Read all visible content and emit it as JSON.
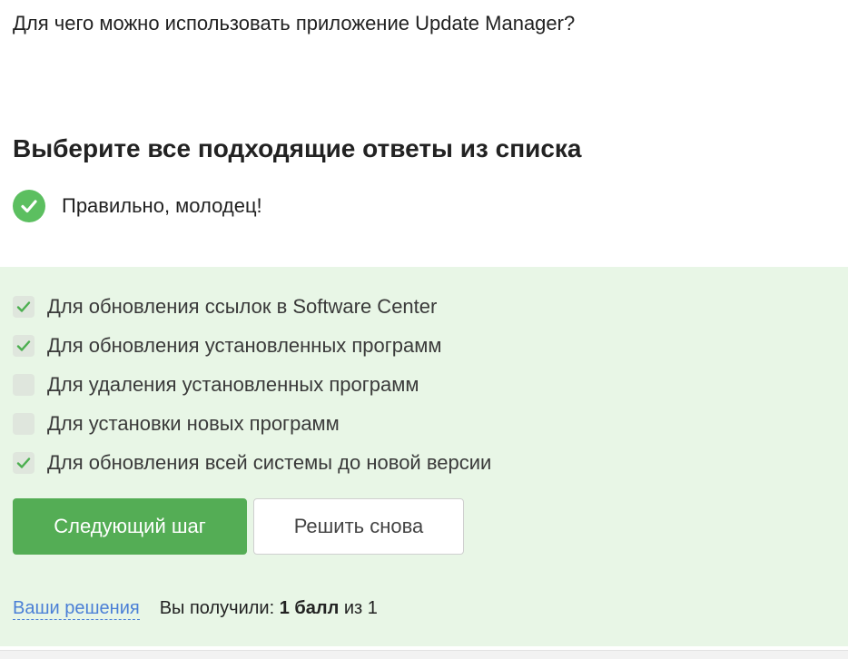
{
  "question": "Для чего можно использовать приложение Update Manager?",
  "instruction": "Выберите все подходящие ответы из списка",
  "feedback": {
    "message": "Правильно, молодец!",
    "icon": "check-circle-icon",
    "color": "#5cbf60"
  },
  "options": [
    {
      "label": "Для обновления ссылок в Software Center",
      "checked": true
    },
    {
      "label": "Для обновления установленных программ",
      "checked": true
    },
    {
      "label": "Для удаления установленных программ",
      "checked": false
    },
    {
      "label": "Для установки новых программ",
      "checked": false
    },
    {
      "label": "Для обновления всей системы до новой версии",
      "checked": true
    }
  ],
  "buttons": {
    "next_label": "Следующий шаг",
    "retry_label": "Решить снова"
  },
  "footer": {
    "solutions_link": "Ваши решения",
    "score_prefix": "Вы получили:",
    "score_value": "1 балл",
    "score_suffix": "из 1"
  },
  "colors": {
    "accent": "#54ad55",
    "panel_bg": "#e8f6e6",
    "link": "#4a7fd6"
  }
}
